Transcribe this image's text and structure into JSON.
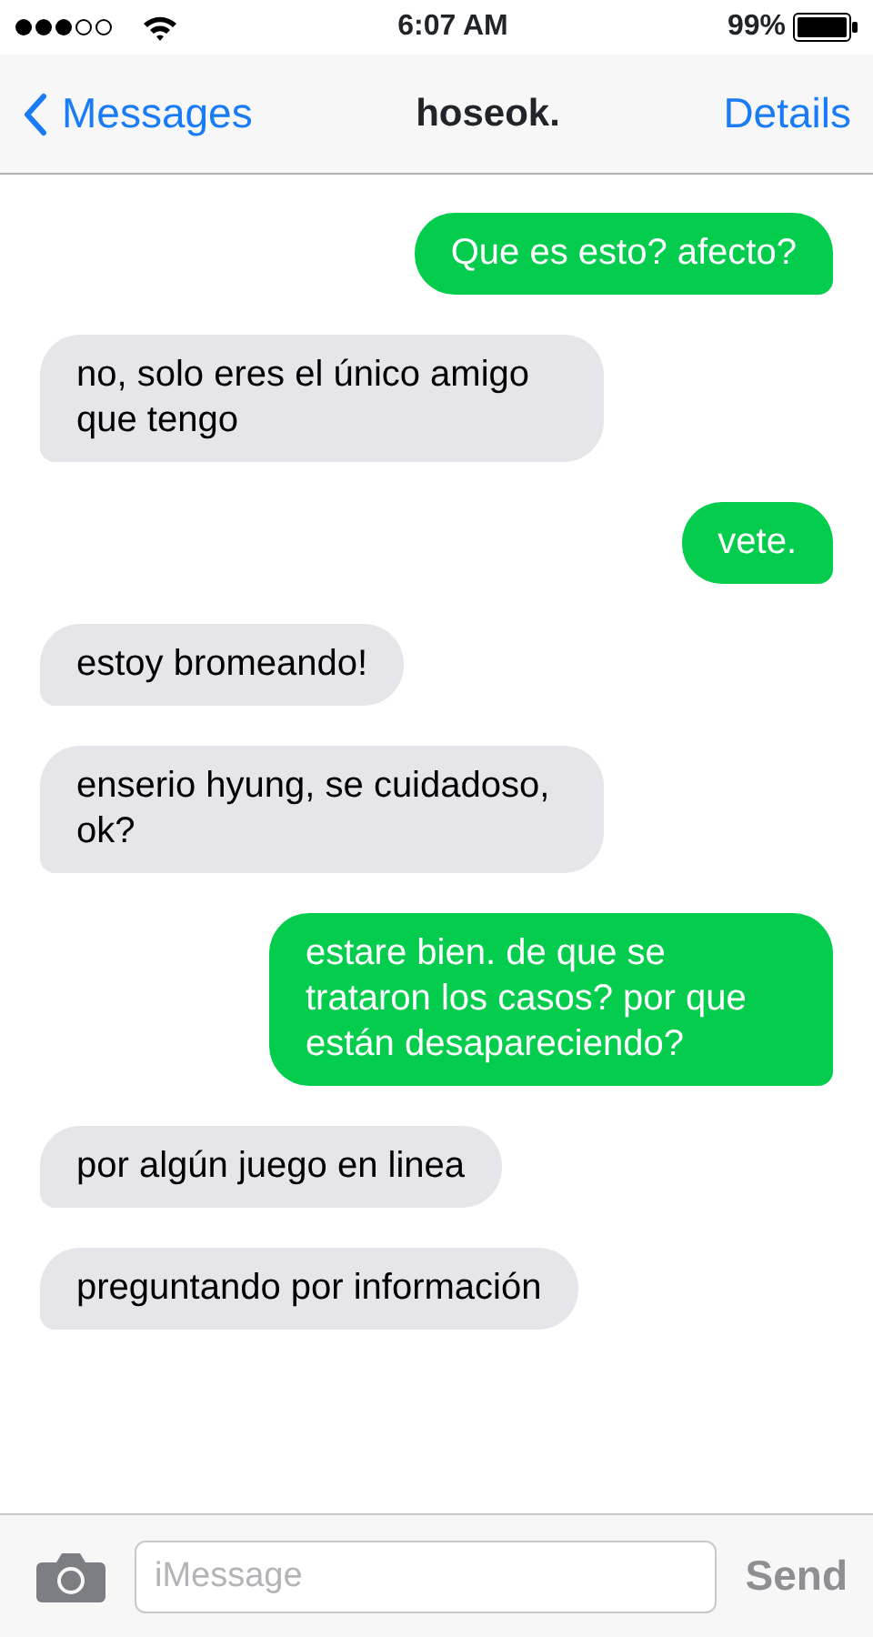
{
  "status_bar": {
    "time": "6:07 AM",
    "battery": "99%"
  },
  "nav": {
    "back": "Messages",
    "title": "hoseok.",
    "action": "Details"
  },
  "messages": [
    {
      "kind": "sent",
      "text": "Que es esto? afecto?"
    },
    {
      "kind": "received",
      "text": "no, solo eres el único amigo que tengo"
    },
    {
      "kind": "sent",
      "text": "vete."
    },
    {
      "kind": "received",
      "text": "estoy bromeando!"
    },
    {
      "kind": "received",
      "text": "enserio hyung, se cuidadoso, ok?"
    },
    {
      "kind": "sent",
      "text": "estare bien. de que se trataron los casos? por que están desapareciendo?"
    },
    {
      "kind": "received",
      "text": "por algún juego en linea"
    },
    {
      "kind": "received",
      "text": "preguntando por información"
    }
  ],
  "composer": {
    "placeholder": "iMessage",
    "send": "Send",
    "send_disabled": true
  }
}
